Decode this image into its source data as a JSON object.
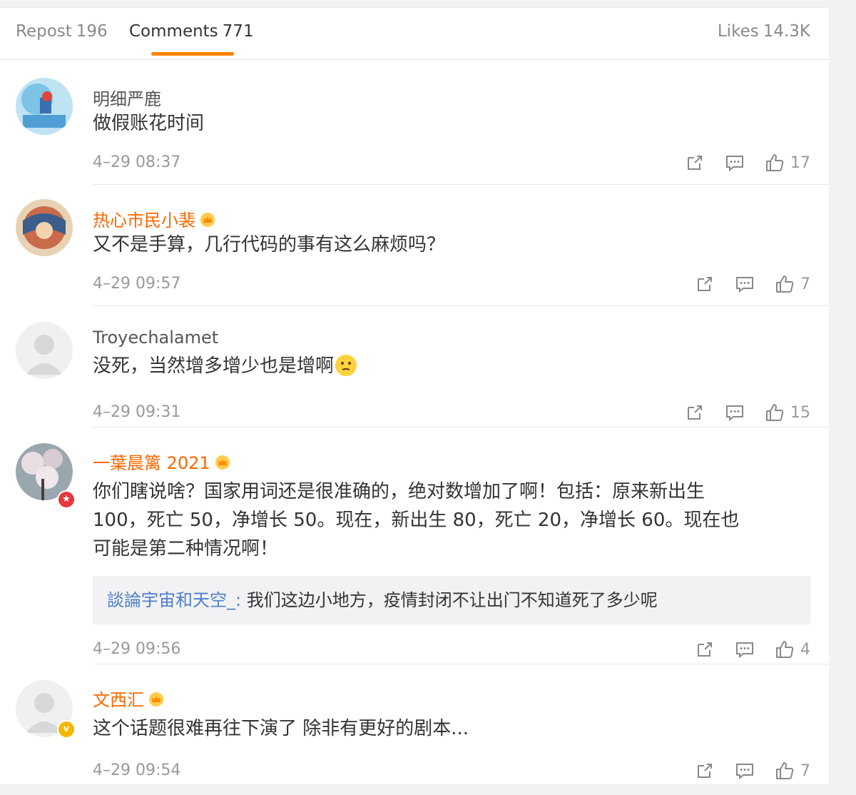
{
  "tabs": {
    "repost_label": "Repost",
    "repost_count": "196",
    "comments_label": "Comments",
    "comments_count": "771",
    "likes_label": "Likes",
    "likes_count": "14.3K"
  },
  "colors": {
    "accent": "#ff8200",
    "member_name": "#ff6600",
    "reply_name": "#4f7ec7"
  },
  "comments": [
    {
      "username": "明细严鹿",
      "text": "做假账花时间",
      "time": "4–29 08:37",
      "likes": "17",
      "member": false
    },
    {
      "username": "热心市民小裴",
      "text": "又不是手算，几行代码的事有这么麻烦吗？",
      "time": "4–29 09:57",
      "likes": "7",
      "member": true
    },
    {
      "username": "Troyechalamet",
      "text": "没死，当然增多增少也是增啊",
      "emoji": "thinking-emoji",
      "time": "4–29 09:31",
      "likes": "15",
      "member": false
    },
    {
      "username": "一葉晨篱 2021",
      "text_lines": [
        "你们瞎说啥？国家用词还是很准确的，绝对数增加了啊！包括：原来新出生",
        "100，死亡 50，净增长 50。现在，新出生 80，死亡 20，净增长 60。现在也",
        "可能是第二种情况啊！"
      ],
      "reply": {
        "name": "談論宇宙和天空_:",
        "text": " 我们这边小地方，疫情封闭不让出门不知道死了多少呢"
      },
      "time": "4–29 09:56",
      "likes": "4",
      "member": true,
      "badge": "red-star-badge"
    },
    {
      "username": "文西汇",
      "text": "这个话题很难再往下演了 除非有更好的剧本...",
      "time": "4–29 09:54",
      "likes": "7",
      "member": true,
      "badge": "verified-v-badge",
      "badge_text": "v"
    }
  ]
}
